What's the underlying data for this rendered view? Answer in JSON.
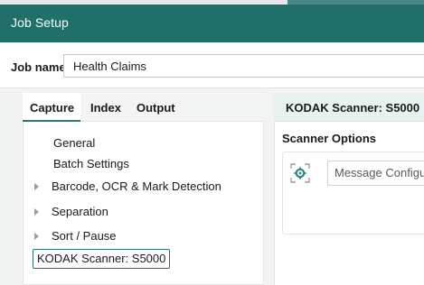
{
  "window": {
    "title": "Job Setup"
  },
  "job": {
    "label": "Job name:",
    "value": "Health Claims"
  },
  "tabs": [
    {
      "label": "Capture",
      "selected": true
    },
    {
      "label": "Index",
      "selected": false
    },
    {
      "label": "Output",
      "selected": false
    }
  ],
  "tree": {
    "items": [
      {
        "label": "General",
        "expandable": false
      },
      {
        "label": "Batch Settings",
        "expandable": false
      },
      {
        "label": "Barcode, OCR & Mark Detection",
        "expandable": true
      },
      {
        "label": "Separation",
        "expandable": true
      },
      {
        "label": "Sort / Pause",
        "expandable": true
      }
    ],
    "selected_label": "KODAK Scanner: S5000"
  },
  "right": {
    "header": "KODAK Scanner: S5000",
    "section_title": "Scanner Options",
    "option_label": "Message Configu",
    "option_icon": "settings-frame-icon"
  },
  "colors": {
    "titlebar": "#216f69",
    "accent": "#2b7a74",
    "right_header_bg": "#e8f2f1"
  }
}
